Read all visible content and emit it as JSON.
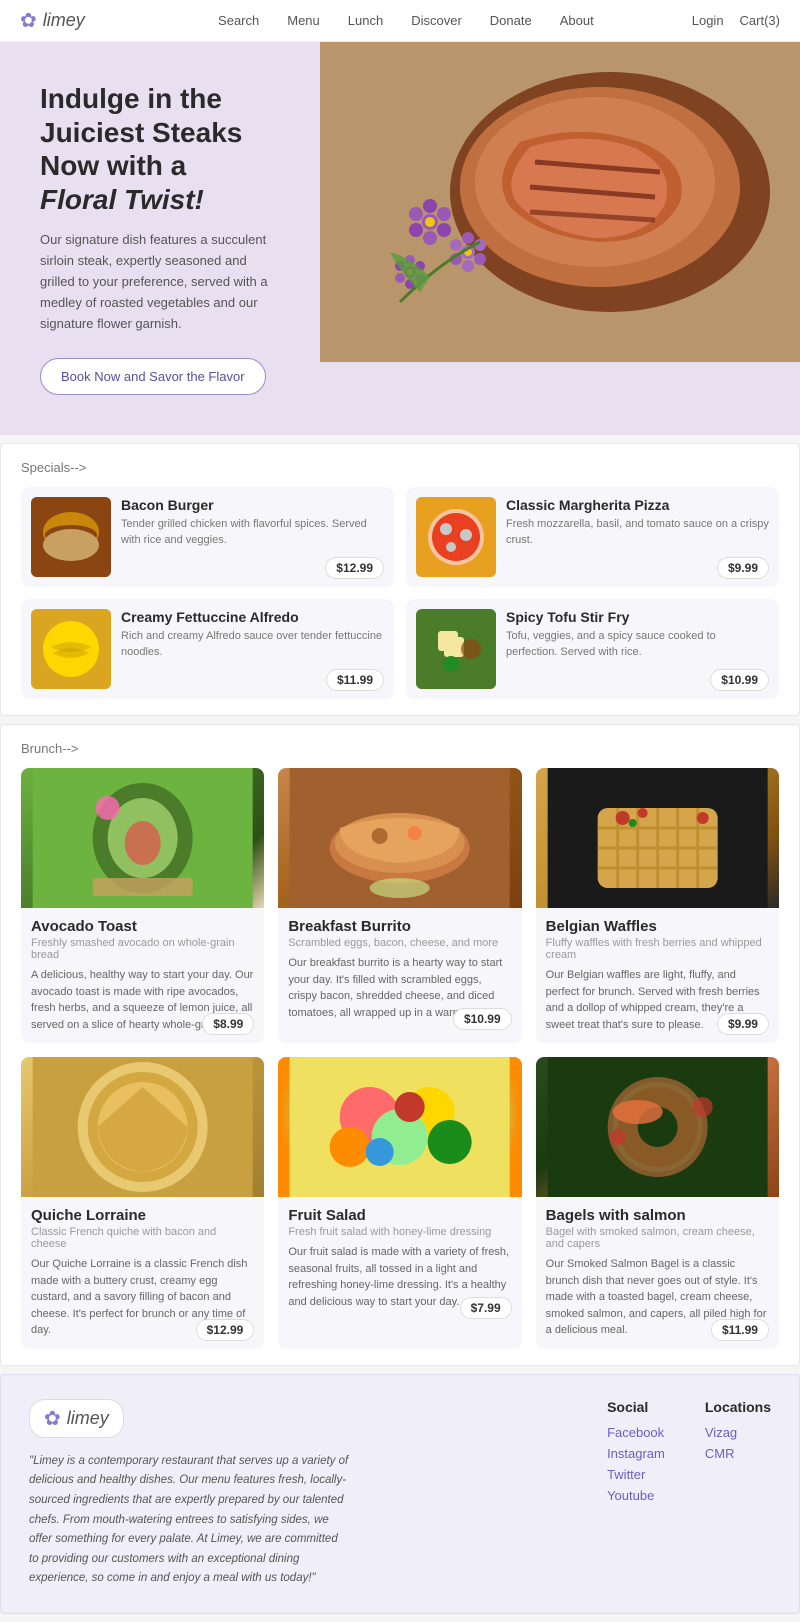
{
  "header": {
    "logo": "limey",
    "nav": [
      "Search",
      "Menu",
      "Lunch",
      "Discover",
      "Donate",
      "About"
    ],
    "login": "Login",
    "cart": "Cart(3)"
  },
  "hero": {
    "line1": "Indulge in the Juiciest Steaks",
    "line2": "Now with a",
    "line3": "Floral Twist!",
    "description": "Our signature dish features a succulent sirloin steak, expertly seasoned and grilled to your preference, served with a medley of roasted vegetables and our signature flower garnish.",
    "button": "Book Now and Savor the Flavor"
  },
  "specials": {
    "title": "Specials-->",
    "items": [
      {
        "name": "Bacon Burger",
        "desc": "Tender grilled chicken with flavorful spices. Served with rice and veggies.",
        "price": "$12.99"
      },
      {
        "name": "Classic Margherita Pizza",
        "desc": "Fresh mozzarella, basil, and tomato sauce on a crispy crust.",
        "price": "$9.99"
      },
      {
        "name": "Creamy Fettuccine Alfredo",
        "desc": "Rich and creamy Alfredo sauce over tender fettuccine noodles.",
        "price": "$11.99"
      },
      {
        "name": "Spicy Tofu Stir Fry",
        "desc": "Tofu, veggies, and a spicy sauce cooked to perfection. Served with rice.",
        "price": "$10.99"
      }
    ]
  },
  "brunch": {
    "title": "Brunch-->",
    "items": [
      {
        "name": "Avocado Toast",
        "sub": "Freshly smashed avocado on whole-grain bread",
        "desc": "A delicious, healthy way to start your day. Our avocado toast is made with ripe avocados, fresh herbs, and a squeeze of lemon juice, all served on a slice of hearty whole-grain bread.",
        "price": "$8.99"
      },
      {
        "name": "Breakfast Burrito",
        "sub": "Scrambled eggs, bacon, cheese, and more",
        "desc": "Our breakfast burrito is a hearty way to start your day. It's filled with scrambled eggs, crispy bacon, shredded cheese, and diced tomatoes, all wrapped up in a warm tortilla.",
        "price": "$10.99"
      },
      {
        "name": "Belgian Waffles",
        "sub": "Fluffy waffles with fresh berries and whipped cream",
        "desc": "Our Belgian waffles are light, fluffy, and perfect for brunch. Served with fresh berries and a dollop of whipped cream, they're a sweet treat that's sure to please.",
        "price": "$9.99"
      },
      {
        "name": "Quiche Lorraine",
        "sub": "Classic French quiche with bacon and cheese",
        "desc": "Our Quiche Lorraine is a classic French dish made with a buttery crust, creamy egg custard, and a savory filling of bacon and cheese. It's perfect for brunch or any time of day.",
        "price": "$12.99"
      },
      {
        "name": "Fruit Salad",
        "sub": "Fresh fruit salad with honey-lime dressing",
        "desc": "Our fruit salad is made with a variety of fresh, seasonal fruits, all tossed in a light and refreshing honey-lime dressing. It's a healthy and delicious way to start your day.",
        "price": "$7.99"
      },
      {
        "name": "Bagels with salmon",
        "sub": "Bagel with smoked salmon, cream cheese, and capers",
        "desc": "Our Smoked Salmon Bagel is a classic brunch dish that never goes out of style. It's made with a toasted bagel, cream cheese, smoked salmon, and capers, all piled high for a delicious meal.",
        "price": "$11.99"
      }
    ]
  },
  "footer": {
    "logo": "limey",
    "description": "\"Limey is a contemporary restaurant that serves up a variety of delicious and healthy dishes. Our menu features fresh, locally-sourced ingredients that are expertly prepared by our talented chefs. From mouth-watering entrees to satisfying sides, we offer something for every palate. At Limey, we are committed to providing our customers with an exceptional dining experience, so come in and enjoy a meal with us today!\"",
    "social": {
      "title": "Social",
      "links": [
        "Facebook",
        "Instagram",
        "Twitter",
        "Youtube"
      ]
    },
    "locations": {
      "title": "Locations",
      "links": [
        "Vizag",
        "CMR"
      ]
    }
  }
}
